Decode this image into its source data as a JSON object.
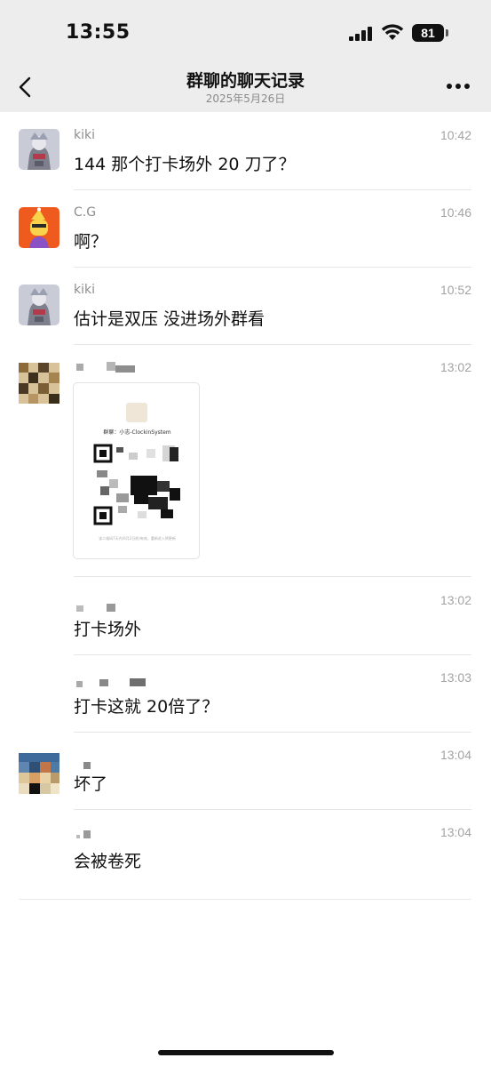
{
  "status_bar": {
    "time": "13:55",
    "battery": "81"
  },
  "nav": {
    "title": "群聊的聊天记录",
    "subtitle": "2025年5月26日"
  },
  "messages": [
    {
      "sender": "kiki",
      "time": "10:42",
      "text": "144 那个打卡场外 20 刀了？"
    },
    {
      "sender": "C.G",
      "time": "10:46",
      "text": "啊？"
    },
    {
      "sender": "kiki",
      "time": "10:52",
      "text": "估计是双压 没进场外群看"
    },
    {
      "sender": "",
      "time": "13:02",
      "text": "",
      "card": {
        "title": "群聊：小志-ClockinSystem",
        "caption": "该二维码7天内(6月2日前)有效，重新进入将更新"
      }
    },
    {
      "sender": "",
      "time": "13:02",
      "text": "打卡场外"
    },
    {
      "sender": "",
      "time": "13:03",
      "text": "打卡这就 20倍了？"
    },
    {
      "sender": "",
      "time": "13:04",
      "text": "坏了"
    },
    {
      "sender": "",
      "time": "13:04",
      "text": "会被卷死"
    }
  ]
}
